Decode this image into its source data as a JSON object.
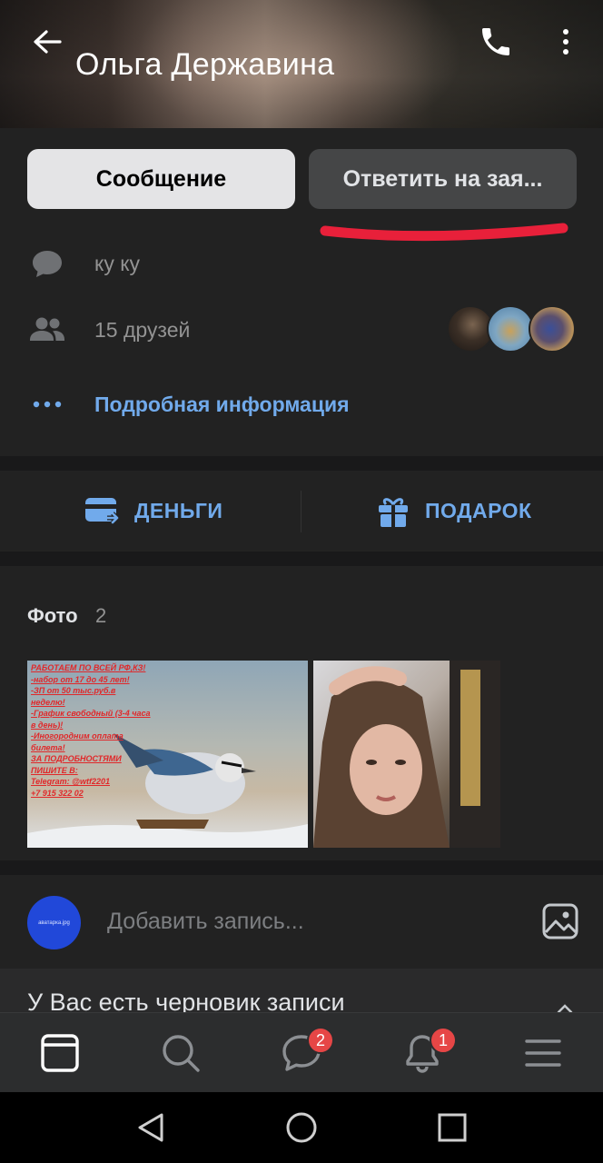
{
  "header": {
    "name": "Ольга Державина"
  },
  "actions": {
    "message_label": "Сообщение",
    "reply_label": "Ответить на зая..."
  },
  "info": {
    "status": "ку ку",
    "friends": "15 друзей",
    "details_link": "Подробная информация"
  },
  "quick_actions": {
    "money_label": "ДЕНЬГИ",
    "gift_label": "ПОДАРОК"
  },
  "photos": {
    "title": "Фото",
    "count": "2",
    "ad_lines": [
      "РАБОТАЕМ ПО ВСЕЙ РФ,КЗ!",
      "-набор от 17 до 45 лет!",
      "-ЗП от 50 тыс.руб.в",
      "неделю!",
      "-График свободный (3-4 часа",
      "в день)!",
      "-Иногородним оплата",
      "билета!",
      "ЗА ПОДРОБНОСТЯМИ",
      "ПИШИТЕ В:",
      "Telegram: @wtf2201",
      "+7 915 322 02"
    ]
  },
  "composer": {
    "avatar_text": "аватарка.jpg",
    "placeholder": "Добавить запись..."
  },
  "draft": {
    "text": "У Вас есть черновик записи"
  },
  "tabbar": {
    "messages_badge": "2",
    "notifications_badge": "1"
  },
  "colors": {
    "accent": "#71aaeb",
    "badge": "#e64646",
    "annotation": "#e8203a"
  }
}
